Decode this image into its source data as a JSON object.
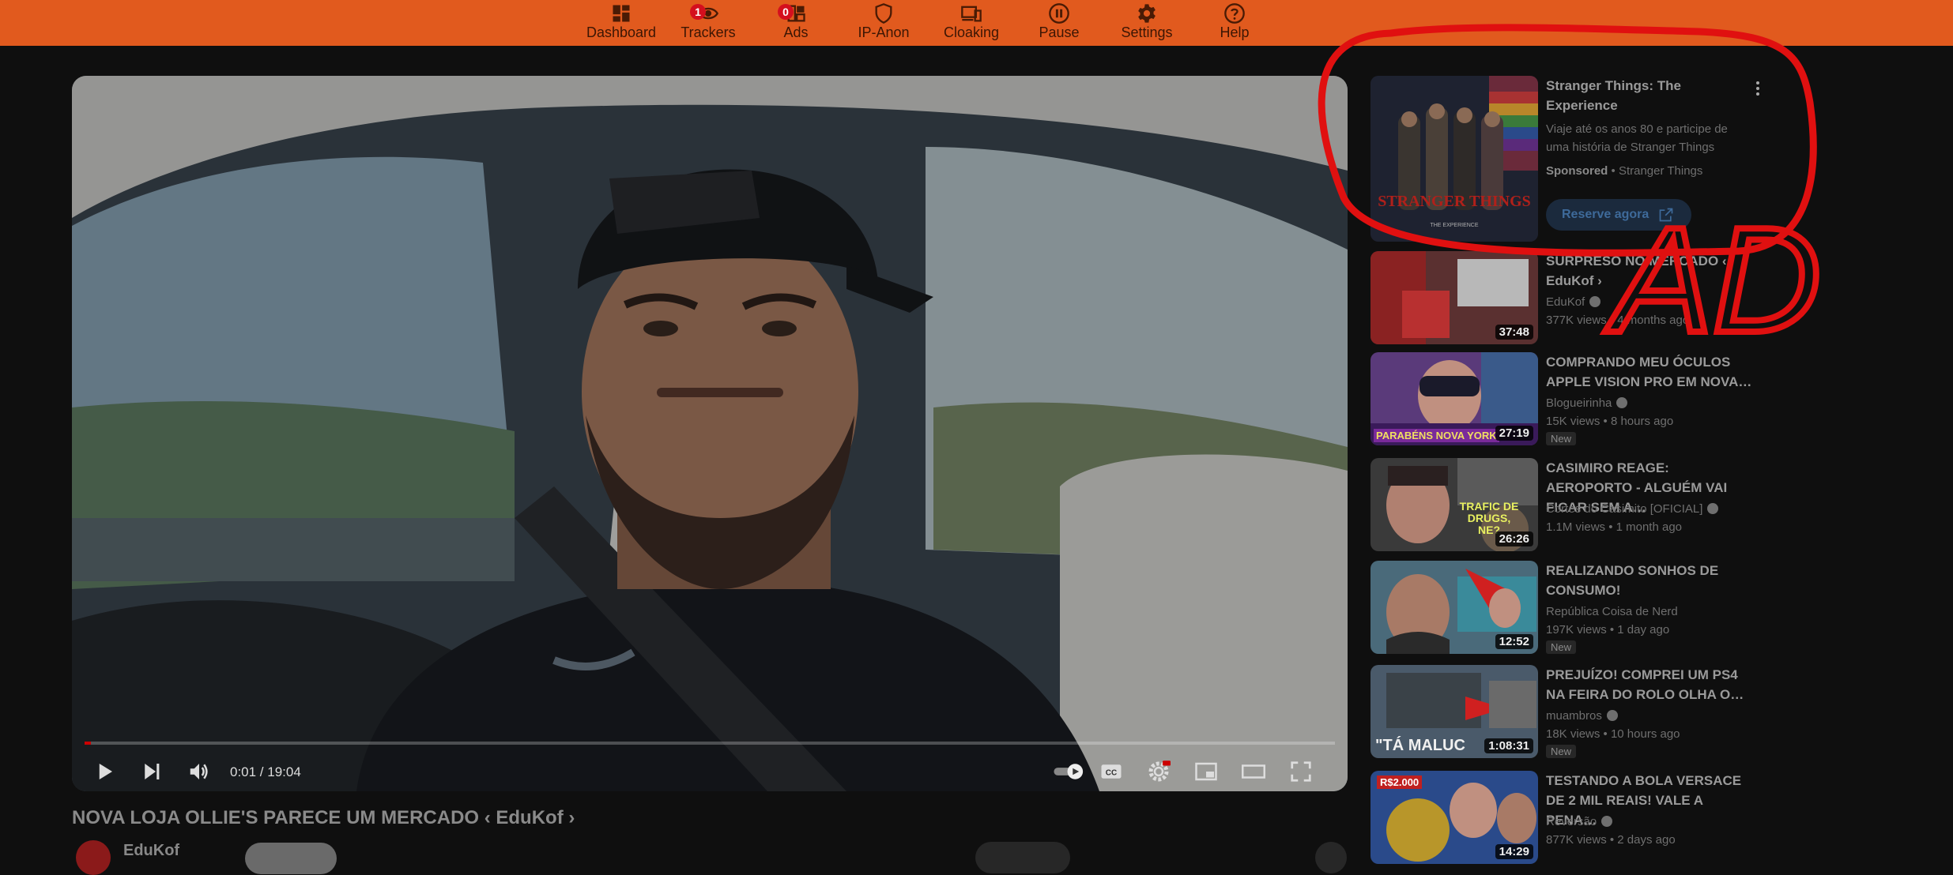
{
  "toolbar": {
    "items": [
      {
        "label": "Dashboard",
        "icon": "dashboard-icon"
      },
      {
        "label": "Trackers",
        "icon": "eye-icon",
        "badge": "1"
      },
      {
        "label": "Ads",
        "icon": "ads-grid-icon",
        "badge": "0"
      },
      {
        "label": "IP-Anon",
        "icon": "shield-icon"
      },
      {
        "label": "Cloaking",
        "icon": "devices-icon"
      },
      {
        "label": "Pause",
        "icon": "pause-icon"
      },
      {
        "label": "Settings",
        "icon": "gear-icon"
      },
      {
        "label": "Help",
        "icon": "help-icon"
      }
    ],
    "color": "#e15a1e"
  },
  "player": {
    "time": "0:01 / 19:04",
    "progress": 0.001,
    "controls": [
      "play-icon",
      "next-icon",
      "volume-icon",
      "autoplay-toggle-icon",
      "captions-icon",
      "settings-icon",
      "miniplayer-icon",
      "theater-icon",
      "fullscreen-icon"
    ]
  },
  "video": {
    "title": "NOVA LOJA OLLIE'S PARECE UM MERCADO ‹ EduKof ›",
    "channel": "EduKof"
  },
  "ad": {
    "title": "Stranger Things: The Experience",
    "description": "Viaje até os anos 80 e participe de uma história de Stranger Things",
    "sponsored": "Sponsored",
    "advertiser": "Stranger Things",
    "cta": "Reserve agora",
    "thumb_logo": "STRANGER THINGS",
    "thumb_sub": "THE EXPERIENCE"
  },
  "annotation": {
    "text": "AD",
    "color": "#e01010"
  },
  "sidebar": [
    {
      "title": "SURPRESO NO MERCADO ‹ EduKof ›",
      "channel": "EduKof",
      "verified": true,
      "stats": "377K views • 4 months ago",
      "duration": "37:48",
      "new": false,
      "thumb": "#7a2a2a"
    },
    {
      "title": "COMPRANDO MEU ÓCULOS APPLE VISION PRO EM NOVA…",
      "channel": "Blogueirinha",
      "verified": true,
      "stats": "15K views • 8 hours ago",
      "duration": "27:19",
      "new": true,
      "thumb": "#5a3a7a",
      "thumb_text": "PARABÉNS NOVA YORK"
    },
    {
      "title": "CASIMIRO REAGE: AEROPORTO - ALGUÉM VAI FICAR SEM A…",
      "channel": "Cortes do Casimito [OFICIAL]",
      "verified": true,
      "stats": "1.1M views • 1 month ago",
      "duration": "26:26",
      "new": false,
      "thumb": "#3a3a3a",
      "thumb_text": "TRAFIC DE DRUGS, NE?"
    },
    {
      "title": "REALIZANDO SONHOS DE CONSUMO!",
      "channel": "República Coisa de Nerd",
      "verified": false,
      "stats": "197K views • 1 day ago",
      "duration": "12:52",
      "new": true,
      "thumb": "#4a6a7a"
    },
    {
      "title": "PREJUÍZO! COMPREI UM PS4 NA FEIRA DO ROLO OLHA O…",
      "channel": "muambros",
      "verified": true,
      "stats": "18K views • 10 hours ago",
      "duration": "1:08:31",
      "new": true,
      "thumb": "#4a5a6a",
      "thumb_text": "\"TÁ MALUC"
    },
    {
      "title": "TESTANDO A BOLA VERSACE DE 2 MIL REAIS! VALE A PENA…",
      "channel": "Reversão",
      "verified": true,
      "stats": "877K views • 2 days ago",
      "duration": "14:29",
      "new": false,
      "thumb": "#2a4a8a",
      "thumb_text": "R$2.000"
    }
  ],
  "new_label": "New"
}
